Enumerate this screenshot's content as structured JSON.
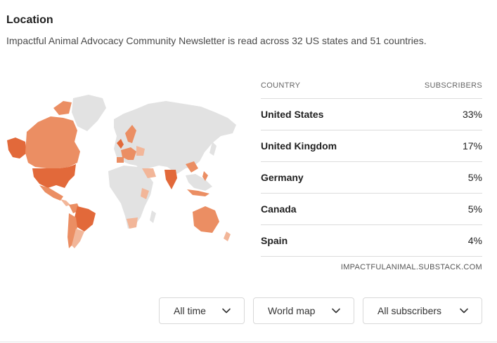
{
  "header": {
    "title": "Location",
    "subtitle": "Impactful Animal Advocacy Community Newsletter is read across 32 US states and 51 countries."
  },
  "table": {
    "col_country": "COUNTRY",
    "col_subscribers": "SUBSCRIBERS",
    "rows": [
      {
        "country": "United States",
        "pct": "33%"
      },
      {
        "country": "United Kingdom",
        "pct": "17%"
      },
      {
        "country": "Germany",
        "pct": "5%"
      },
      {
        "country": "Canada",
        "pct": "5%"
      },
      {
        "country": "Spain",
        "pct": "4%"
      }
    ],
    "source": "IMPACTFULANIMAL.SUBSTACK.COM"
  },
  "filters": {
    "time": "All time",
    "view": "World map",
    "audience": "All subscribers"
  },
  "colors": {
    "map_base": "#e2e2e2",
    "heat_dark": "#e2693a",
    "heat_mid": "#eb8e63",
    "heat_light": "#f2b699"
  },
  "icons": [
    "chevron-down-icon"
  ]
}
